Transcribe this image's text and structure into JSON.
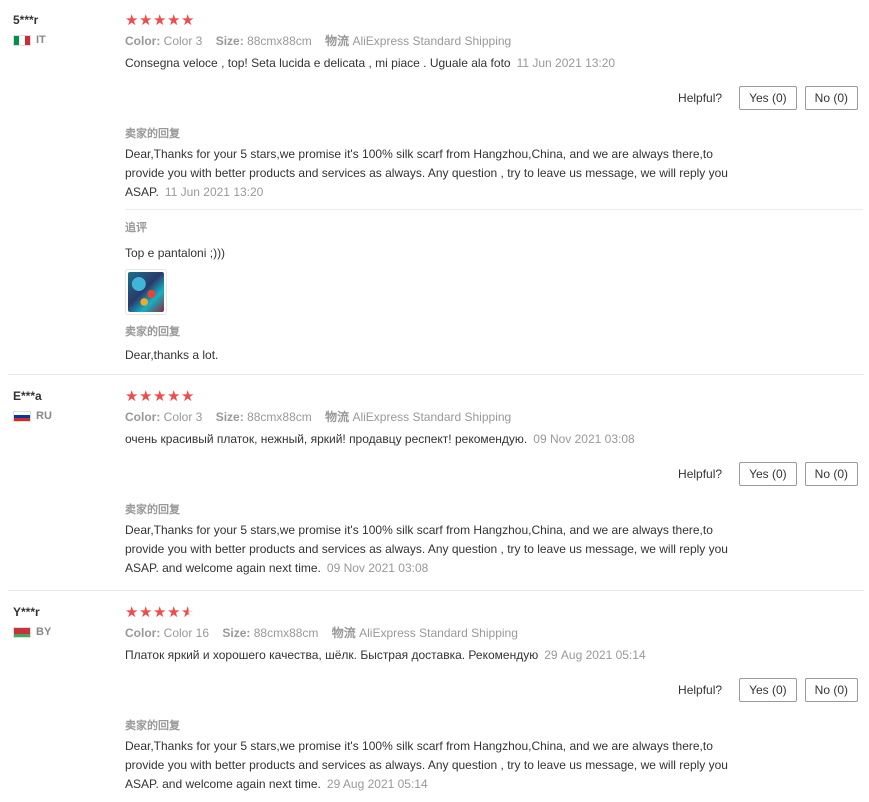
{
  "labels": {
    "color": "Color:",
    "size": "Size:",
    "shipping": "物流",
    "helpful": "Helpful?",
    "seller_reply": "卖家的回复",
    "additional_feedback": "追评"
  },
  "colors": {
    "star": "#f14b4b",
    "muted": "#999999",
    "text": "#333333"
  },
  "reviews": [
    {
      "user": "5***r",
      "country": "IT",
      "flag": [
        "#009246",
        "#ffffff",
        "#ce2b37"
      ],
      "rating": 5,
      "color": "Color 3",
      "size": "88cmx88cm",
      "shipping": "AliExpress Standard Shipping",
      "text": "Consegna veloce , top! Seta lucida e delicata , mi piace . Uguale ala foto",
      "date": "11 Jun 2021 13:20",
      "yes": "Yes (0)",
      "no": "No (0)",
      "reply": "Dear,Thanks for your 5 stars,we promise it's 100% silk scarf from Hangzhou,China, and we are always there,to provide you with better products and services as always. Any question , try to leave us message, we will reply you ASAP.",
      "reply_date": "11 Jun 2021 13:20",
      "followup": "Top e pantaloni ;)))",
      "followup_image": "scarf-photo",
      "followup_reply": "Dear,thanks a lot."
    },
    {
      "user": "E***a",
      "country": "RU",
      "flag": [
        "#ffffff",
        "#0039a6",
        "#d52b1e"
      ],
      "rating": 5,
      "color": "Color 3",
      "size": "88cmx88cm",
      "shipping": "AliExpress Standard Shipping",
      "text": "очень красивый платок, нежный, яркий! продавцу респект! рекомендую.",
      "date": "09 Nov 2021 03:08",
      "yes": "Yes (0)",
      "no": "No (0)",
      "reply": "Dear,Thanks for your 5 stars,we promise it's 100% silk scarf from Hangzhou,China, and we are always there,to provide you with better products and services as always. Any question , try to leave us message, we will reply you ASAP. and welcome again next time.",
      "reply_date": "09 Nov 2021 03:08"
    },
    {
      "user": "Y***r",
      "country": "BY",
      "flag": [
        "#c8313e",
        "#c8313e",
        "#4aa657"
      ],
      "rating": 4.5,
      "color": "Color 16",
      "size": "88cmx88cm",
      "shipping": "AliExpress Standard Shipping",
      "text": "Платок яркий и хорошего качества, шёлк. Быстрая доставка. Рекомендую",
      "date": "29 Aug 2021 05:14",
      "yes": "Yes (0)",
      "no": "No (0)",
      "reply": "Dear,Thanks for your 5 stars,we promise it's 100% silk scarf from Hangzhou,China, and we are always there,to provide you with better products and services as always. Any question , try to leave us message, we will reply you ASAP. and welcome again next time.",
      "reply_date": "29 Aug 2021 05:14"
    }
  ]
}
